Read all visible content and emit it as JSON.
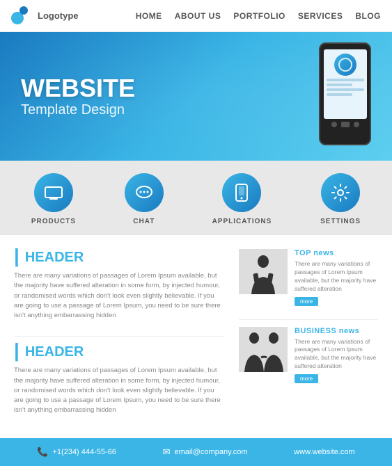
{
  "nav": {
    "logo_text": "Logotype",
    "links": [
      "HOME",
      "ABOUT US",
      "PORTFOLIO",
      "SERVICES",
      "BLOG"
    ]
  },
  "hero": {
    "title": "WEBSITE",
    "subtitle": "Template Design"
  },
  "features": [
    {
      "id": "products",
      "label": "PRODUCTS",
      "icon": "💻"
    },
    {
      "id": "chat",
      "label": "CHAT",
      "icon": "💬"
    },
    {
      "id": "applications",
      "label": "APPLICATIONS",
      "icon": "📱"
    },
    {
      "id": "settings",
      "label": "SETTINGS",
      "icon": "⚙"
    }
  ],
  "sections": [
    {
      "id": "section1",
      "title": "HEADER",
      "text": "There are many variations of passages of Lorem Ipsum available, but the majority have suffered alteration in some form, by injected humour, or randomised words which don't look even slightly believable. If you are going to use a passage of Lorem Ipsum, you need to be sure there isn't anything embarrassing hidden"
    },
    {
      "id": "section2",
      "title": "HEADER",
      "text": "There are many variations of passages of Lorem Ipsum available, but the majority have suffered alteration in some form, by injected humour, or randomised words which don't look even slightly believable. If you are going to use a passage of Lorem Ipsum, you need to be sure there isn't anything embarrassing hidden"
    }
  ],
  "news": [
    {
      "id": "top-news",
      "title": "TOP news",
      "text": "There are many variations of passages of Lorem Ipsum available, but the majority have suffered alteration",
      "more": "more"
    },
    {
      "id": "business-news",
      "title": "BUSINESS news",
      "text": "There are many variations of passages of Lorem Ipsum available, but the majority have suffered alteration",
      "more": "more"
    }
  ],
  "footer": {
    "phone": "+1(234) 444-55-66",
    "email": "email@company.com",
    "website": "www.website.com"
  }
}
